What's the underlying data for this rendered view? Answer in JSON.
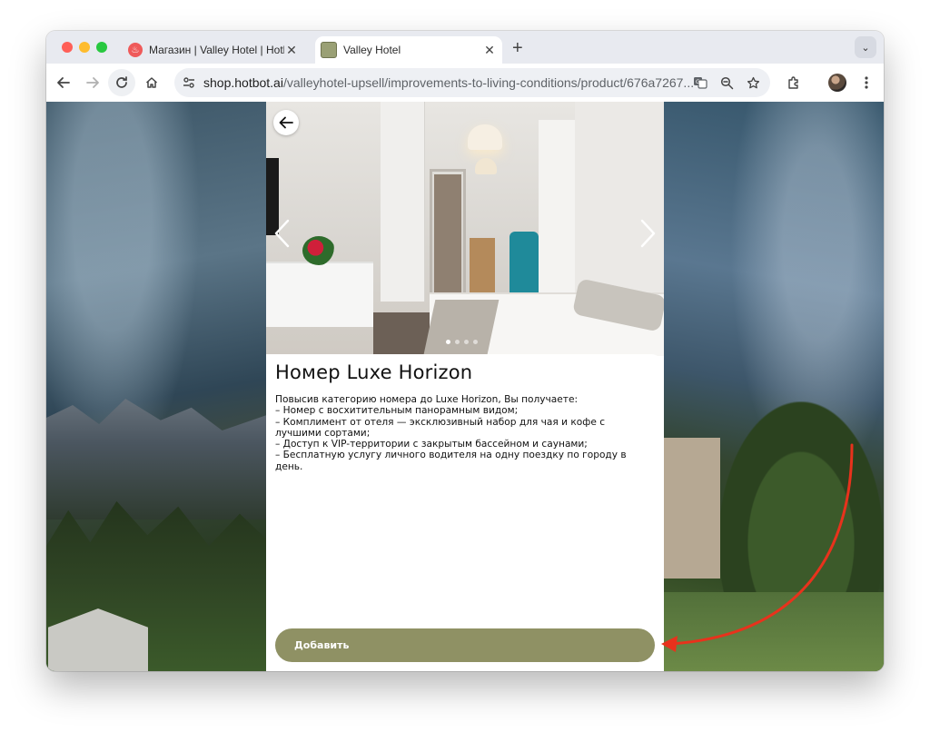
{
  "browser": {
    "tabs": [
      {
        "title": "Магазин | Valley Hotel | Hotbot",
        "active": false
      },
      {
        "title": "Valley Hotel",
        "active": true
      }
    ],
    "url_host": "shop.hotbot.ai",
    "url_path": "/valleyhotel-upsell/improvements-to-living-conditions/product/676a7267..."
  },
  "product": {
    "title": "Номер Luxe Horizon",
    "description_lines": [
      "Повысив категорию номера до Luxe Horizon, Вы получаете:",
      "– Номер с восхитительным панорамным видом;",
      "– Комплимент от отеля — эксклюзивный набор для чая и кофе с лучшими сортами;",
      "– Доступ к VIP-территории с закрытым бассейном и саунами;",
      "– Бесплатную услугу личного водителя на одну поездку по городу в день."
    ],
    "add_button": "Добавить",
    "gallery": {
      "total": 4,
      "active": 1
    }
  },
  "colors": {
    "accent": "#8f9164",
    "annotation_arrow": "#e8321c"
  }
}
